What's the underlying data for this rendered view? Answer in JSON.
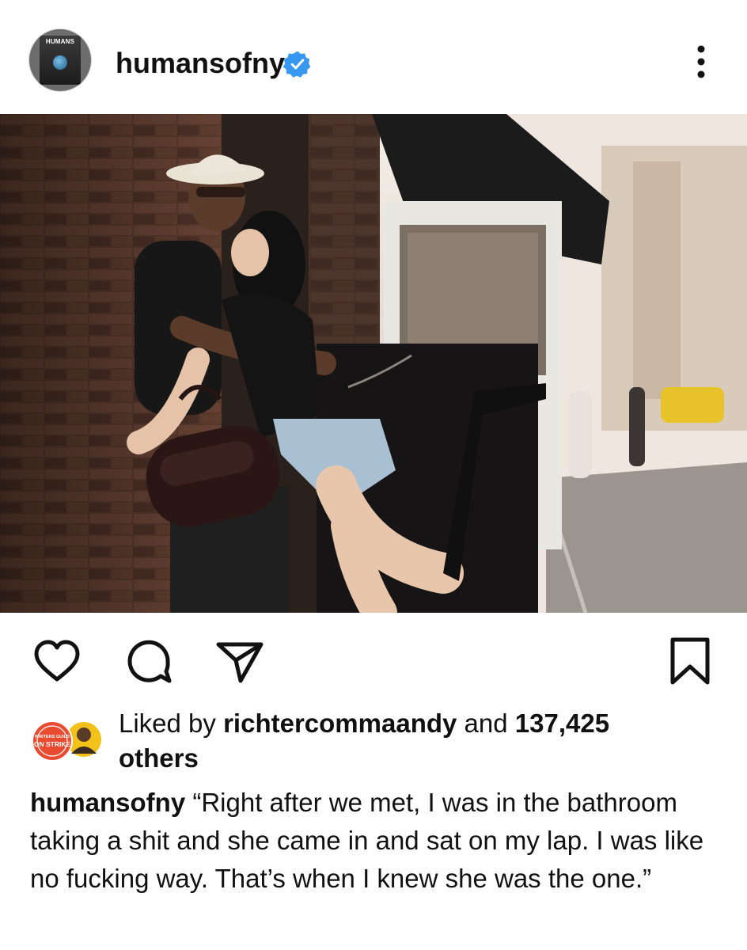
{
  "post": {
    "username": "humansofny",
    "avatar_text": "HUMANS",
    "verified_icon": "verified-badge-icon",
    "accent_color": "#3897f0"
  },
  "actions": {
    "like_icon": "heart-icon",
    "comment_icon": "comment-icon",
    "share_icon": "send-icon",
    "save_icon": "bookmark-icon",
    "more_icon": "more-vertical-icon"
  },
  "likes": {
    "prefix": "Liked by",
    "liker": "richtercommaandy",
    "conjunction": "and",
    "count": "137,425",
    "suffix": "others",
    "liker_avatar_text_1": "WRITERS GUILD",
    "liker_avatar_text_2": "ON STRIKE"
  },
  "caption": {
    "username": "humansofny",
    "text": "“Right after we met, I was in the bathroom taking a shit and she came in and sat on my lap. I was like no fucking way. That’s when I knew she was the one.”"
  }
}
